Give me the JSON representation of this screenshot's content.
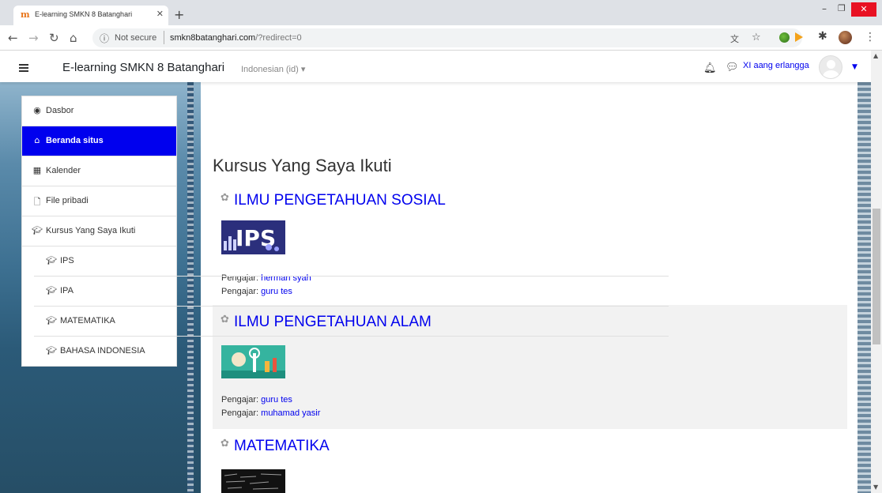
{
  "browser": {
    "tab_title": "E-learning SMKN 8 Batanghari",
    "tab_favicon": "m",
    "security_label": "Not secure",
    "url_host": "smkn8batanghari.com",
    "url_path": "/?redirect=0",
    "icons": [
      "back-icon",
      "forward-icon",
      "reload-icon",
      "home-icon",
      "info-icon",
      "translate-icon",
      "star-icon",
      "extension-icon",
      "menu-icon"
    ]
  },
  "navbar": {
    "site_name": "E-learning SMKN 8 Batanghari",
    "language": "Indonesian (id)",
    "user_name": "XI aang erlangga"
  },
  "sidebar": {
    "items": [
      {
        "label": "Dasbor",
        "icon": "dashboard-icon",
        "active": false
      },
      {
        "label": "Beranda situs",
        "icon": "home-icon",
        "active": true
      },
      {
        "label": "Kalender",
        "icon": "calendar-icon",
        "active": false
      },
      {
        "label": "File pribadi",
        "icon": "file-icon",
        "active": false
      },
      {
        "label": "Kursus Yang Saya Ikuti",
        "icon": "graduation-cap-icon",
        "active": false
      },
      {
        "label": "IPS",
        "icon": "graduation-cap-icon",
        "active": false
      },
      {
        "label": "IPA",
        "icon": "graduation-cap-icon",
        "active": false
      },
      {
        "label": "MATEMATIKA",
        "icon": "graduation-cap-icon",
        "active": false
      },
      {
        "label": "BAHASA INDONESIA",
        "icon": "graduation-cap-icon",
        "active": false
      }
    ]
  },
  "main": {
    "heading": "Kursus Yang Saya Ikuti",
    "teacher_prefix": "Pengajar: ",
    "courses": [
      {
        "name": "ILMU PENGETAHUAN SOSIAL",
        "image_text": "IPS",
        "teachers": [
          "herman syah",
          "guru tes"
        ]
      },
      {
        "name": "ILMU PENGETAHUAN ALAM",
        "teachers": [
          "guru tes",
          "muhamad yasir"
        ]
      },
      {
        "name": "MATEMATIKA",
        "teachers": []
      }
    ]
  },
  "colors": {
    "link": "#0000ee",
    "active_nav": "#0000ee",
    "close_button": "#e81123"
  }
}
